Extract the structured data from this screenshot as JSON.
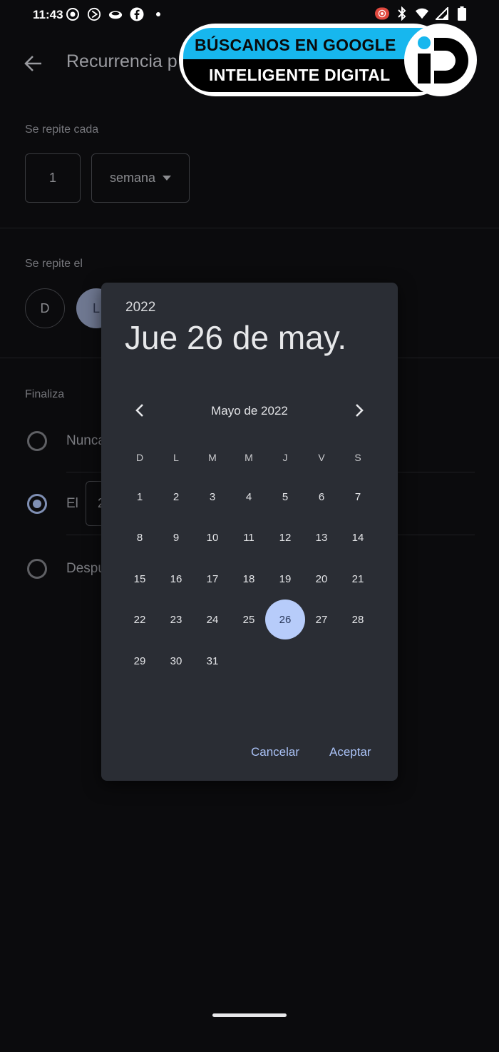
{
  "status_bar": {
    "time": "11:43",
    "left_icons": [
      "record-icon",
      "play-icon",
      "cloud-icon",
      "facebook-icon",
      "dot-icon"
    ],
    "right_icons": [
      "screen-record-icon",
      "bluetooth-icon",
      "wifi-icon",
      "signal-icon",
      "battery-icon"
    ]
  },
  "page": {
    "title": "Recurrencia p",
    "repeat_every_label": "Se repite cada",
    "interval_value": "1",
    "unit_value": "semana",
    "repeat_on_label": "Se repite el",
    "day_chips": [
      "D",
      "L"
    ],
    "ends_label": "Finaliza",
    "end_options": [
      "Nunca",
      "El",
      "Despu"
    ],
    "end_date_fragment": "2"
  },
  "watermark": {
    "line1": "BÚSCANOS EN GOOGLE",
    "line2": "INTELIGENTE DIGITAL",
    "colors": {
      "top": "#17b7ee",
      "bottom": "#000000",
      "logo_dot": "#17b7ee"
    }
  },
  "dialog": {
    "year": "2022",
    "selected_date": "Jue 26 de may.",
    "month_label": "Mayo de 2022",
    "weekdays": [
      "D",
      "L",
      "M",
      "M",
      "J",
      "V",
      "S"
    ],
    "weeks": [
      [
        "1",
        "2",
        "3",
        "4",
        "5",
        "6",
        "7"
      ],
      [
        "8",
        "9",
        "10",
        "11",
        "12",
        "13",
        "14"
      ],
      [
        "15",
        "16",
        "17",
        "18",
        "19",
        "20",
        "21"
      ],
      [
        "22",
        "23",
        "24",
        "25",
        "26",
        "27",
        "28"
      ],
      [
        "29",
        "30",
        "31"
      ]
    ],
    "selected_day": "26",
    "cancel_label": "Cancelar",
    "accept_label": "Aceptar",
    "colors": {
      "surface": "#2a2d34",
      "accent": "#b7ccfa",
      "button_text": "#a9c1f5"
    }
  }
}
